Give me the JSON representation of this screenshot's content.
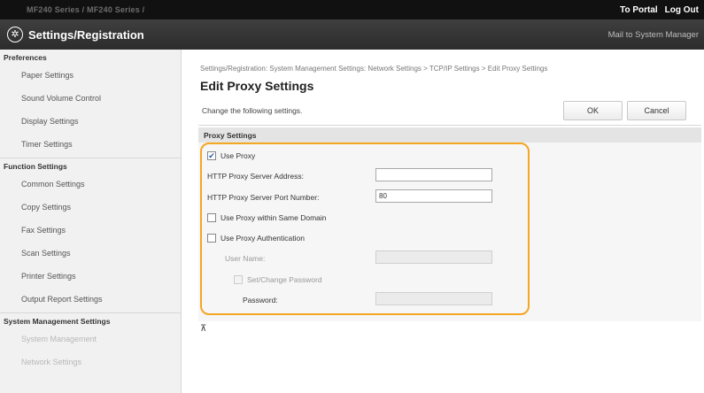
{
  "topbar": {
    "device": "MF240 Series / MF240 Series /",
    "to_portal": "To Portal",
    "log_out": "Log Out"
  },
  "titlebar": {
    "title": "Settings/Registration",
    "mail": "Mail to System Manager"
  },
  "sidebar": {
    "groups": [
      {
        "heading": "Preferences",
        "items": [
          "Paper Settings",
          "Sound Volume Control",
          "Display Settings",
          "Timer Settings"
        ]
      },
      {
        "heading": "Function Settings",
        "items": [
          "Common Settings",
          "Copy Settings",
          "Fax Settings",
          "Scan Settings",
          "Printer Settings",
          "Output Report Settings"
        ]
      },
      {
        "heading": "System Management Settings",
        "items": [
          "System Management",
          "Network Settings"
        ]
      }
    ]
  },
  "main": {
    "breadcrumb": "Settings/Registration: System Management Settings: Network Settings > TCP/IP Settings > Edit Proxy Settings",
    "title": "Edit Proxy Settings",
    "instruction": "Change the following settings.",
    "ok_label": "OK",
    "cancel_label": "Cancel",
    "section_title": "Proxy Settings",
    "use_proxy_label": "Use Proxy",
    "use_proxy_checked": true,
    "server_address_label": "HTTP Proxy Server Address:",
    "server_address_value": "",
    "port_label": "HTTP Proxy Server Port Number:",
    "port_value": "80",
    "same_domain_label": "Use Proxy within Same Domain",
    "same_domain_checked": false,
    "auth_label": "Use Proxy Authentication",
    "auth_checked": false,
    "user_name_label": "User Name:",
    "user_name_value": "",
    "set_password_label": "Set/Change Password",
    "password_label": "Password:",
    "password_value": "",
    "to_top": "⊼"
  },
  "colors": {
    "highlight": "#f5a623",
    "header_bg": "#111111",
    "title_bg": "#333333"
  },
  "icons": {
    "title_icon": "gear-icon",
    "to_top_icon": "arrow-to-top-icon"
  }
}
